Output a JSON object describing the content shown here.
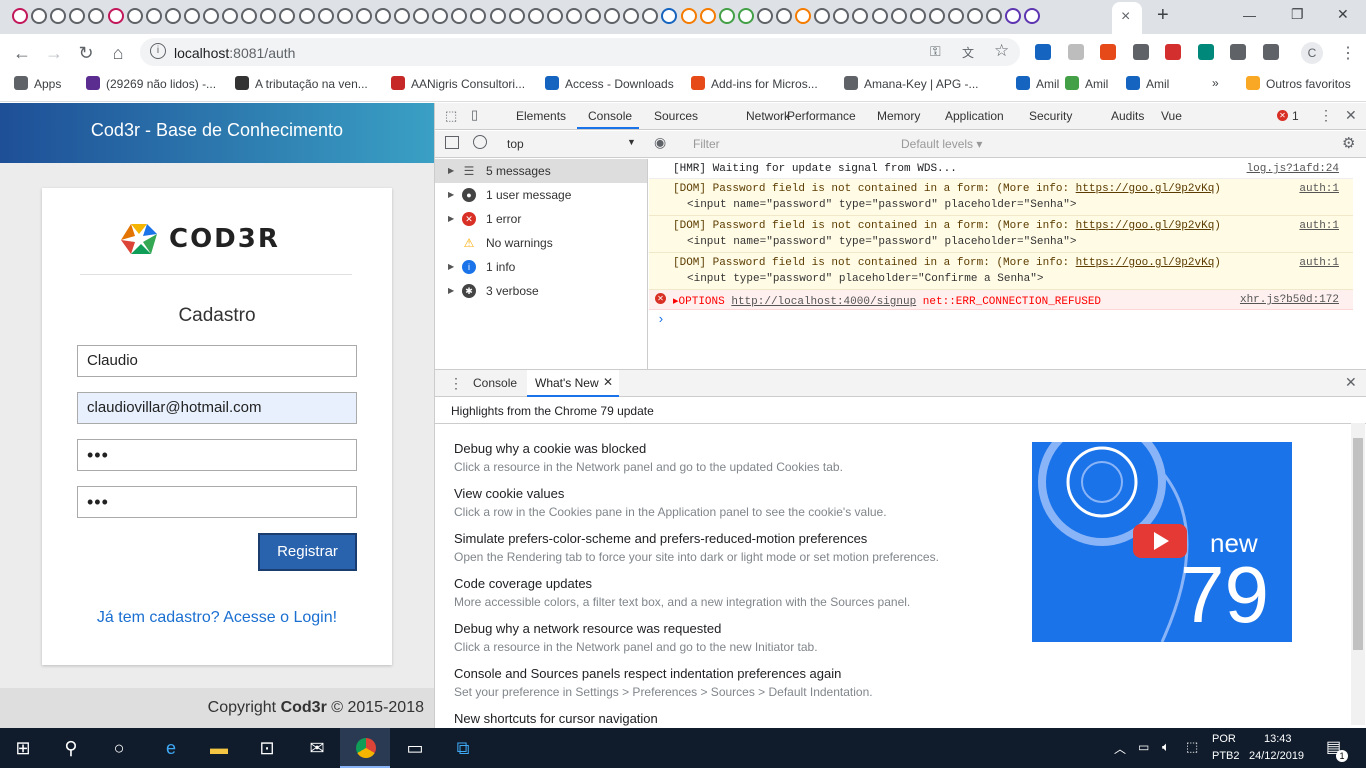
{
  "browser": {
    "new_tab_glyph": "+",
    "close_tab_glyph": "×",
    "window_controls": [
      "—",
      "❐",
      "✕"
    ],
    "url_host": "localhost",
    "url_rest": ":8081/auth",
    "profile_initial": "C"
  },
  "bookmarks": [
    {
      "label": "Apps"
    },
    {
      "label": "(29269 não lidos) -..."
    },
    {
      "label": "A tributação na ven..."
    },
    {
      "label": "AANigris Consultori..."
    },
    {
      "label": "Access - Downloads"
    },
    {
      "label": "Add-ins for Micros..."
    },
    {
      "label": "Amana-Key | APG -..."
    },
    {
      "label": "Amil"
    },
    {
      "label": "Amil"
    },
    {
      "label": "Amil"
    },
    {
      "label": "»"
    },
    {
      "label": "Outros favoritos"
    }
  ],
  "app": {
    "header_title": "Cod3r - Base de Conhecimento",
    "logo_text": "COD3R",
    "form_title": "Cadastro",
    "name_value": "Claudio",
    "email_value": "claudiovillar@hotmail.com",
    "password_mask": "•••",
    "confirm_mask": "•••",
    "register_label": "Registrar",
    "login_link": "Já tem cadastro? Acesse o Login!",
    "footer_prefix": "Copyright ",
    "footer_brand": "Cod3r",
    "footer_suffix": " © 2015-2018"
  },
  "devtools": {
    "tabs": [
      "Elements",
      "Console",
      "Sources",
      "Network",
      "Performance",
      "Memory",
      "Application",
      "Security",
      "Audits",
      "Vue"
    ],
    "active_tab": "Console",
    "error_count": "1",
    "context": "top",
    "filter_placeholder": "Filter",
    "levels": "Default levels ▾",
    "sidebar": [
      {
        "label": "5 messages",
        "icon": "list-icon"
      },
      {
        "label": "1 user message",
        "icon": "user-icon"
      },
      {
        "label": "1 error",
        "icon": "error-icon"
      },
      {
        "label": "No warnings",
        "icon": "warning-icon"
      },
      {
        "label": "1 info",
        "icon": "info-icon"
      },
      {
        "label": "3 verbose",
        "icon": "bug-icon"
      }
    ],
    "messages": [
      {
        "line1": "[HMR] Waiting for update signal from WDS...",
        "line2": "",
        "source": "log.js?1afd:24"
      },
      {
        "line1_pre": "[DOM] Password field is not contained in a form: (More info: ",
        "link": "https://goo.gl/9p2vKq",
        "line1_post": ")",
        "line2": "<input name=\"password\" type=\"password\" placeholder=\"Senha\">",
        "source": "auth:1"
      },
      {
        "line1_pre": "[DOM] Password field is not contained in a form: (More info: ",
        "link": "https://goo.gl/9p2vKq",
        "line1_post": ")",
        "line2": "<input name=\"password\" type=\"password\" placeholder=\"Senha\">",
        "source": "auth:1"
      },
      {
        "line1_pre": "[DOM] Password field is not contained in a form: (More info: ",
        "link": "https://goo.gl/9p2vKq",
        "line1_post": ")",
        "line2": "<input type=\"password\" placeholder=\"Confirme a Senha\">",
        "source": "auth:1"
      },
      {
        "line1_pre": "▸OPTIONS ",
        "link": "http://localhost:4000/signup",
        "line1_post": " net::ERR_CONNECTION_REFUSED",
        "source": "xhr.js?b50d:172"
      }
    ],
    "prompt": "›",
    "drawer_tabs": [
      "Console",
      "What's New"
    ],
    "highlights": "Highlights from the Chrome 79 update",
    "features": [
      {
        "title": "Debug why a cookie was blocked",
        "desc": "Click a resource in the Network panel and go to the updated Cookies tab."
      },
      {
        "title": "View cookie values",
        "desc": "Click a row in the Cookies pane in the Application panel to see the cookie's value."
      },
      {
        "title": "Simulate prefers-color-scheme and prefers-reduced-motion preferences",
        "desc": "Open the Rendering tab to force your site into dark or light mode or set motion preferences."
      },
      {
        "title": "Code coverage updates",
        "desc": "More accessible colors, a filter text box, and a new integration with the Sources panel."
      },
      {
        "title": "Debug why a network resource was requested",
        "desc": "Click a resource in the Network panel and go to the new Initiator tab."
      },
      {
        "title": "Console and Sources panels respect indentation preferences again",
        "desc": "Set your preference in Settings > Preferences > Sources > Default Indentation."
      },
      {
        "title": "New shortcuts for cursor navigation",
        "desc": ""
      }
    ],
    "video_new": "new",
    "video_num": "79"
  },
  "taskbar": {
    "lang": "POR",
    "layout": "PTB2",
    "time": "13:43",
    "date": "24/12/2019",
    "notif_count": "1"
  }
}
